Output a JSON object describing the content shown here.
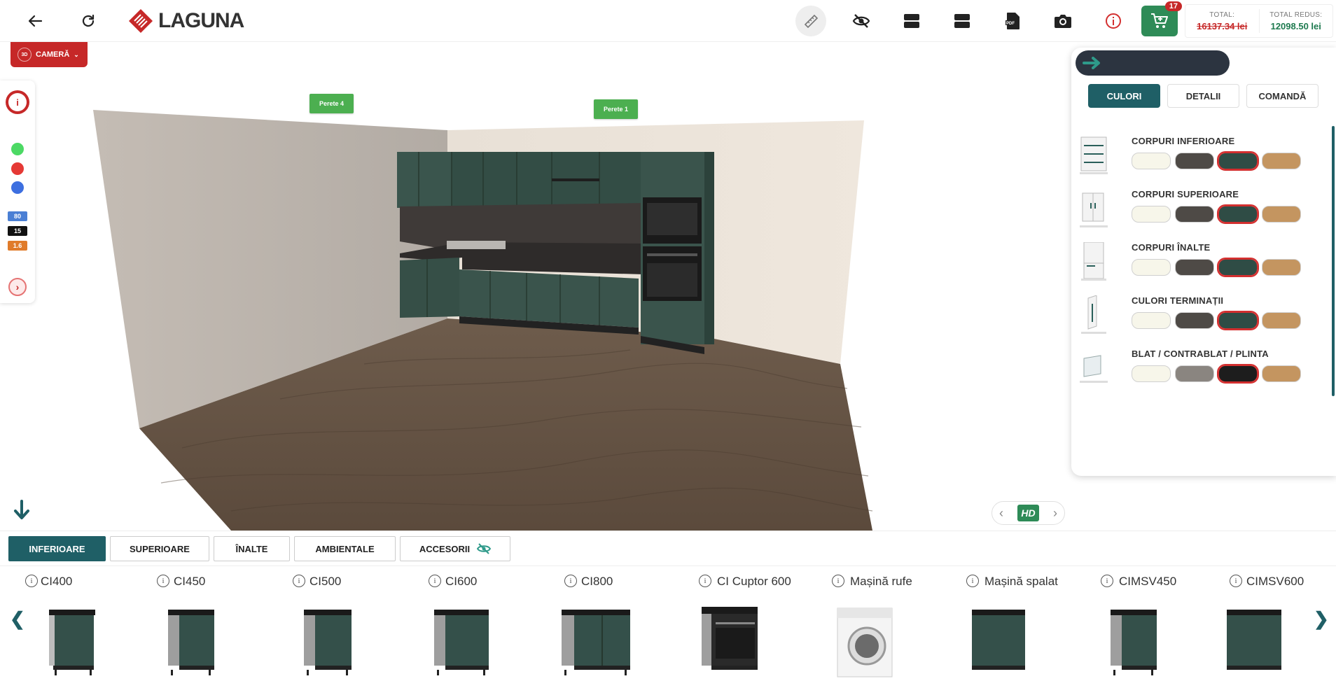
{
  "brand": {
    "logo_text": "LAGUNA"
  },
  "topbar": {
    "icons": [
      "back-arrow-icon",
      "refresh-icon",
      "ruler-icon",
      "eye-off-icon",
      "layout-icon",
      "layout-alt-icon",
      "pdf-icon",
      "camera-icon",
      "info-icon",
      "cart-icon"
    ],
    "cart_count": "17",
    "total_label": "TOTAL:",
    "total_value": "16137.34 lei",
    "reduced_label": "TOTAL REDUS:",
    "reduced_value": "12098.50 lei"
  },
  "camera": {
    "label": "CAMERĂ",
    "badge": "3D"
  },
  "left_panel": {
    "dots": [
      "#4cd964",
      "#e53935",
      "#3d6fe0"
    ],
    "chips": [
      {
        "label": "80",
        "color": "#4a7fd4"
      },
      {
        "label": "15",
        "color": "#111111"
      },
      {
        "label": "1.6",
        "color": "#e07b2a"
      }
    ]
  },
  "walls": {
    "wall4": "Perete 4",
    "wall1": "Perete 1"
  },
  "hd": {
    "label": "HD"
  },
  "right_panel": {
    "tabs": [
      "CULORI",
      "DETALII",
      "COMANDĂ"
    ],
    "active_tab": "CULORI",
    "categories": [
      {
        "title": "CORPURI INFERIOARE",
        "swatches": [
          "#f7f6ea",
          "#4e4a46",
          "#2f4c45",
          "#c49560"
        ],
        "selected": 2
      },
      {
        "title": "CORPURI SUPERIOARE",
        "swatches": [
          "#f7f6ea",
          "#4e4a46",
          "#2f4c45",
          "#c49560"
        ],
        "selected": 2
      },
      {
        "title": "CORPURI ÎNALTE",
        "swatches": [
          "#f7f6ea",
          "#4e4a46",
          "#2f4c45",
          "#c49560"
        ],
        "selected": 2
      },
      {
        "title": "CULORI TERMINAȚII",
        "swatches": [
          "#f7f6ea",
          "#4e4a46",
          "#2f4c45",
          "#c49560"
        ],
        "selected": 2
      },
      {
        "title": "BLAT / CONTRABLAT / PLINTA",
        "swatches": [
          "#f7f6ea",
          "#8a8580",
          "#1d1d1d",
          "#c49560"
        ],
        "selected": 2
      }
    ]
  },
  "bottom_tabs": [
    "INFERIOARE",
    "SUPERIOARE",
    "ÎNALTE",
    "AMBIENTALE",
    "ACCESORII"
  ],
  "active_bottom_tab": "INFERIOARE",
  "products": [
    "CI400",
    "CI450",
    "CI500",
    "CI600",
    "CI800",
    "CI Cuptor 600",
    "Mașină rufe",
    "Mașină spalat",
    "CIMSV450",
    "CIMSV600"
  ]
}
